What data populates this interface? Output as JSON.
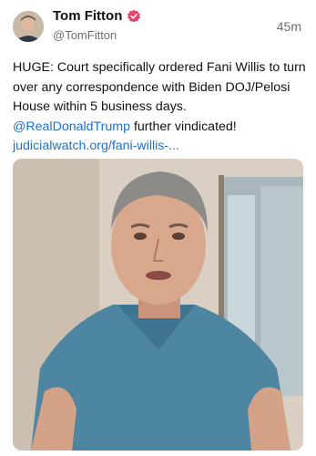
{
  "author": {
    "display_name": "Tom Fitton",
    "handle": "@TomFitton",
    "verified_color": "#e8456b"
  },
  "post": {
    "timestamp": "45m",
    "text_main": "HUGE: Court specifically ordered Fani Willis to turn over any correspondence with Biden DOJ/Pelosi House within 5 business days.",
    "mention": "@RealDonaldTrump",
    "text_after_mention": " further vindicated!",
    "link": "judicialwatch.org/fani-willis-..."
  },
  "colors": {
    "link": "#1f6fd1",
    "secondary_text": "#6b6f73"
  },
  "icons": {
    "verified": "verified-badge-icon"
  }
}
